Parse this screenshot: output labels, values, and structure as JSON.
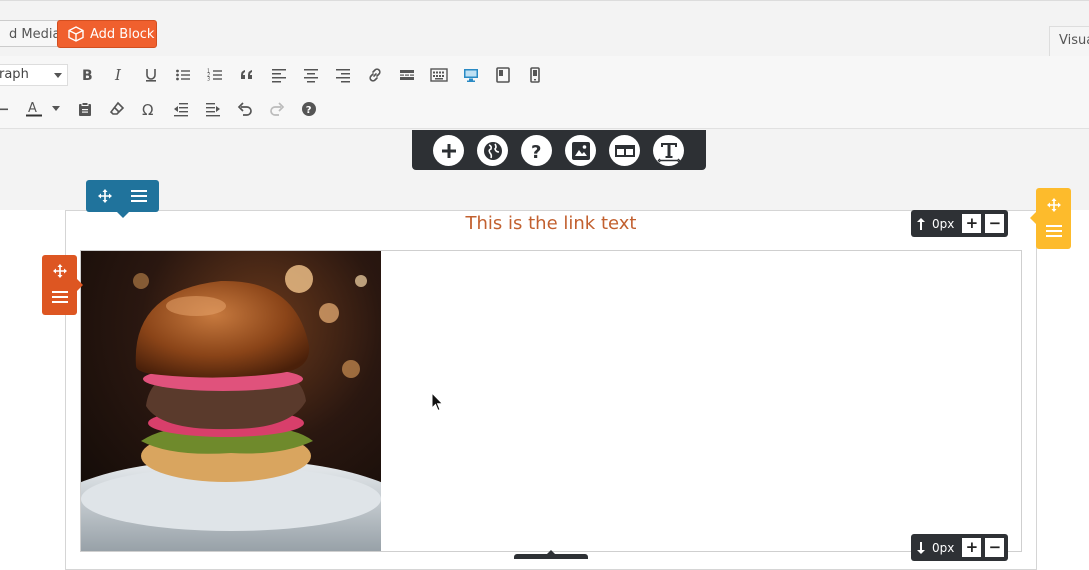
{
  "header": {
    "add_media_label": "d Media",
    "add_block_label": "Add Block",
    "visual_tab_label": "Visua"
  },
  "toolbar": {
    "format_value": "raph",
    "row1_icons": [
      "bold-icon",
      "italic-icon",
      "underline-icon",
      "bullet-list-icon",
      "numbered-list-icon",
      "blockquote-icon",
      "align-left-icon",
      "align-center-icon",
      "align-right-icon",
      "link-icon",
      "read-more-icon",
      "keyboard-icon",
      "desktop-view-icon",
      "tablet-view-icon",
      "mobile-view-icon"
    ],
    "row2_icons": [
      "horizontal-line-icon",
      "text-color-icon",
      "paste-text-icon",
      "clear-formatting-icon",
      "special-character-icon",
      "outdent-icon",
      "indent-icon",
      "undo-icon",
      "redo-icon",
      "help-icon"
    ],
    "active_color": "#2a8ac4"
  },
  "float_toolbar": {
    "icons": [
      "add-icon",
      "globe-icon",
      "help-icon",
      "image-icon",
      "layout-icon",
      "text-icon"
    ]
  },
  "content": {
    "link_text": "This is the link text",
    "top_padding": "0px",
    "bottom_padding": "0px",
    "plus": "+",
    "minus": "−"
  },
  "colors": {
    "accent_orange": "#f0602e",
    "handle_blue": "#20739c",
    "handle_orange": "#dd5622",
    "handle_yellow": "#fdbb2c",
    "link_color": "#c2602f"
  }
}
